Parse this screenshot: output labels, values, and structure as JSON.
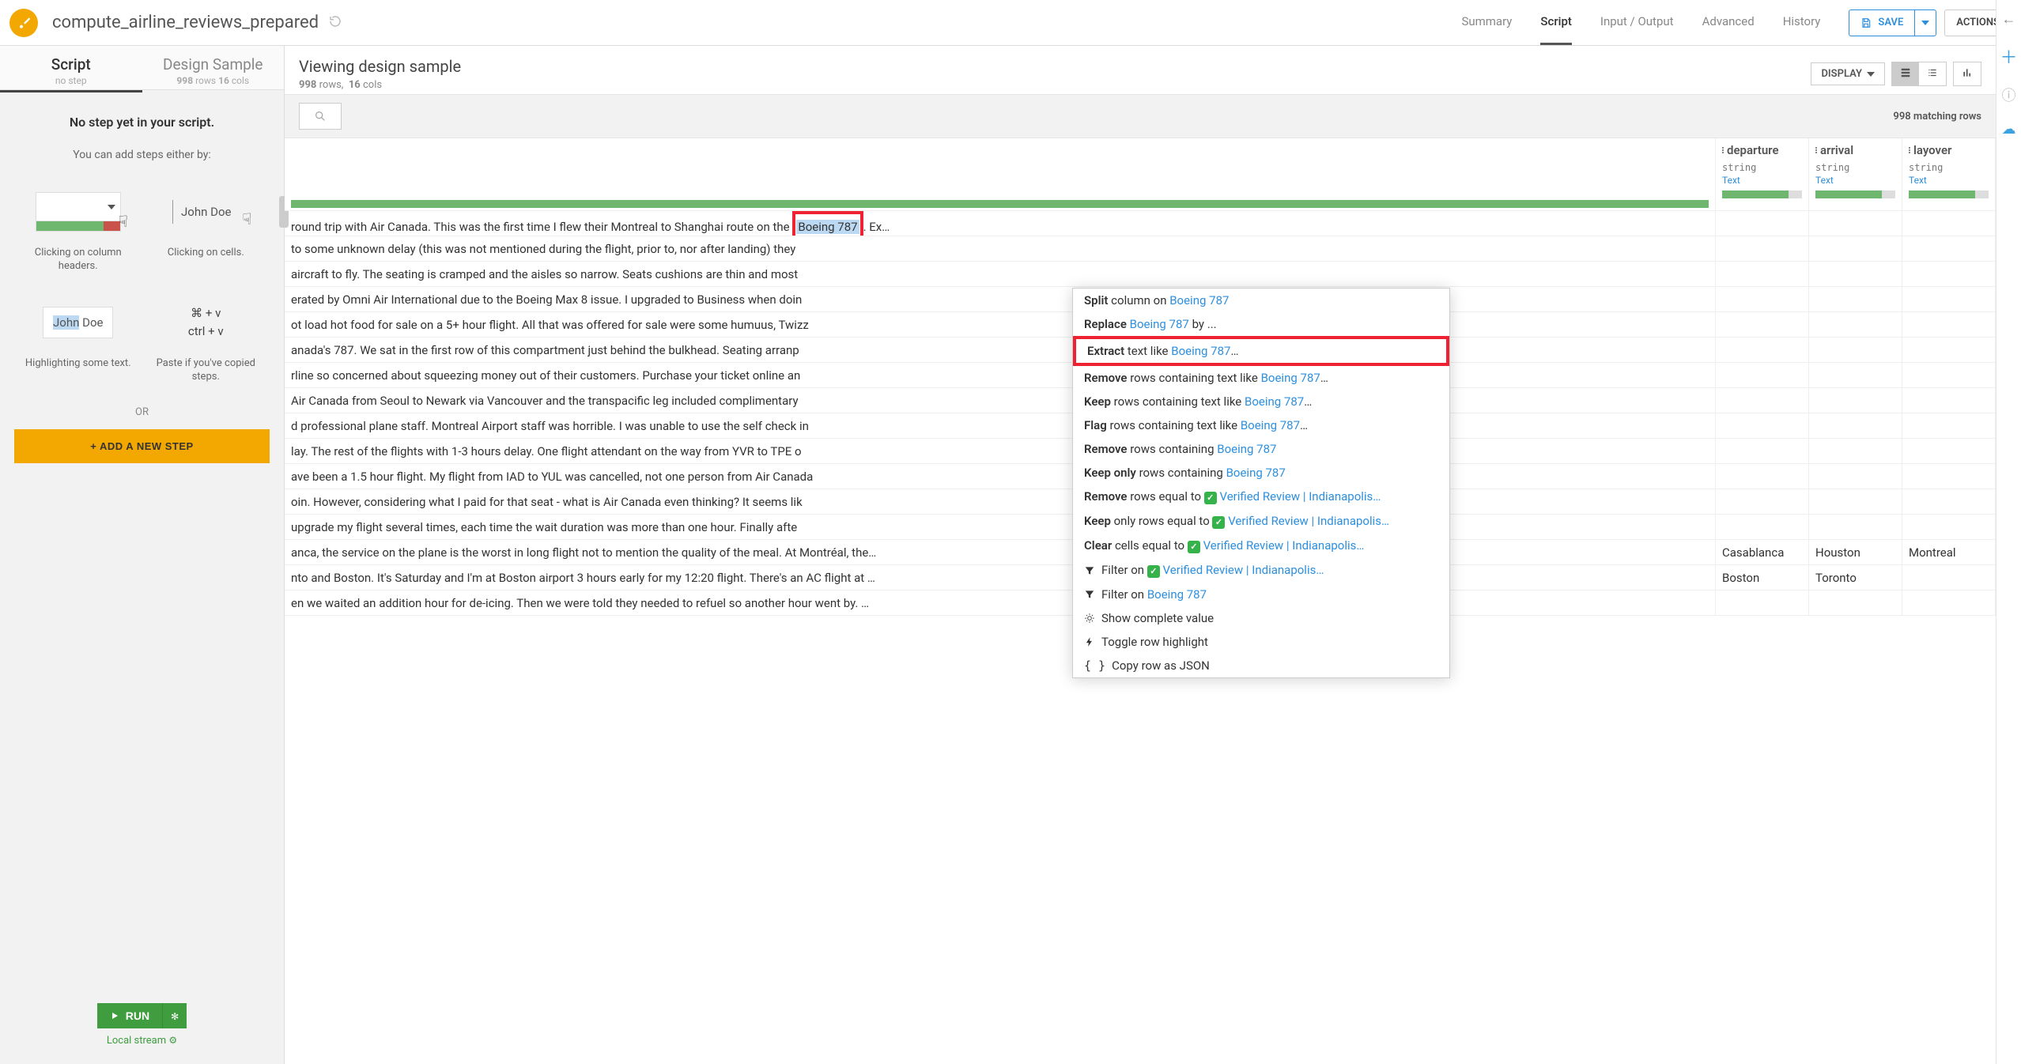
{
  "recipe_title": "compute_airline_reviews_prepared",
  "top_tabs": [
    "Summary",
    "Script",
    "Input / Output",
    "Advanced",
    "History"
  ],
  "top_tab_active": "Script",
  "save_label": "SAVE",
  "actions_label": "ACTIONS",
  "left": {
    "tab1": {
      "title": "Script",
      "sub": "no step"
    },
    "tab2": {
      "title": "Design Sample",
      "sub_rows": "998",
      "sub_rows_lbl": "rows",
      "sub_cols": "16",
      "sub_cols_lbl": "cols"
    },
    "no_step_msg": "No step yet in your script.",
    "add_intro": "You can add steps either by:",
    "hint_col": "Clicking on column headers.",
    "hint_cell_name": "John Doe",
    "hint_cell": "Clicking on cells.",
    "hint_hl_word": "John",
    "hint_hl_rest": " Doe",
    "hint_hl": "Highlighting some text.",
    "paste_line1": "⌘  +  v",
    "paste_line2": "ctrl  +  v",
    "hint_paste": "Paste if you've copied steps.",
    "or": "OR",
    "add_step_btn": "+ ADD A NEW STEP",
    "run_btn": "RUN",
    "local_stream": "Local stream"
  },
  "right": {
    "viewing": "Viewing design sample",
    "rows": "998",
    "rows_lbl": "rows,",
    "cols": "16",
    "cols_lbl": "cols",
    "display_label": "DISPLAY",
    "matching": "998 matching rows"
  },
  "columns": {
    "departure": {
      "label": "departure",
      "type": "string",
      "meaning": "Text"
    },
    "arrival": {
      "label": "arrival",
      "type": "string",
      "meaning": "Text"
    },
    "layover": {
      "label": "layover",
      "type": "string",
      "meaning": "Text"
    }
  },
  "selected_token": "Boeing 787",
  "rows": [
    {
      "review_pre": "round trip with Air Canada. This was the first time I flew their Montreal to Shanghai route on the ",
      "review_hit": "Boeing 787",
      "review_post": ". Ex…"
    },
    {
      "review": "to some unknown delay (this was not mentioned during the flight, prior to, nor after landing) they"
    },
    {
      "review": "aircraft to fly. The seating is cramped and the aisles so narrow. Seats cushions are thin and most"
    },
    {
      "review": "erated by Omni Air International due to the Boeing Max 8 issue. I upgraded to Business when doin"
    },
    {
      "review": "ot load hot food for sale on a 5+ hour flight. All that was offered for sale were some humuus, Twizz"
    },
    {
      "review": "anada's 787. We sat in the first row of this compartment just behind the bulkhead. Seating arranp"
    },
    {
      "review": "rline so concerned about squeezing money out of their customers. Purchase your ticket online an"
    },
    {
      "review": "Air Canada from Seoul to Newark via Vancouver and the transpacific leg included complimentary"
    },
    {
      "review": "d professional plane staff. Montreal Airport staff was horrible. I was unable to use the self check in"
    },
    {
      "review": "lay. The rest of the flights with 1-3 hours delay. One flight attendant on the way from YVR to TPE o"
    },
    {
      "review": "ave been a 1.5 hour flight. My flight from IAD to YUL was cancelled, not one person from Air Canada"
    },
    {
      "review": "oin. However, considering what I paid for that seat - what is Air Canada even thinking? It seems lik"
    },
    {
      "review": "upgrade my flight several times, each time the wait duration was more than one hour. Finally afte"
    },
    {
      "review": "anca, the service on the plane is the worst in long flight not to mention the quality of the meal. At Montréal, the…",
      "departure": "Casablanca",
      "arrival": "Houston",
      "layover": "Montreal"
    },
    {
      "review": "nto and Boston. It's Saturday and I'm at Boston airport 3 hours early for my 12:20 flight. There's an AC flight at …",
      "departure": "Boston",
      "arrival": "Toronto"
    },
    {
      "review": "en we waited an addition hour for de-icing. Then we were told they needed to refuel so another hour went by. …"
    }
  ],
  "menu": {
    "split": {
      "pre": "Split",
      "mid": " column on ",
      "link": "Boeing 787"
    },
    "replace": {
      "pre": "Replace ",
      "link": "Boeing 787",
      "post": " by ..."
    },
    "extract": {
      "pre": "Extract",
      "mid": " text like ",
      "link": "Boeing 787",
      "post": "…"
    },
    "remove_like": {
      "pre": "Remove",
      "mid": " rows containing text like ",
      "link": "Boeing 787",
      "post": "…"
    },
    "keep_like": {
      "pre": "Keep",
      "mid": " rows containing text like ",
      "link": "Boeing 787",
      "post": "…"
    },
    "flag_like": {
      "pre": "Flag",
      "mid": " rows containing text like ",
      "link": "Boeing 787",
      "post": "…"
    },
    "remove_containing": {
      "pre": "Remove",
      "mid": " rows containing ",
      "link": "Boeing 787"
    },
    "keep_containing": {
      "pre": "Keep only",
      "mid": " rows containing ",
      "link": "Boeing 787"
    },
    "remove_eq": {
      "pre": "Remove",
      "mid": " rows equal to ",
      "val": "Verified Review | Indianapolis…"
    },
    "keep_eq": {
      "pre": "Keep",
      "mid": " only rows equal to ",
      "val": "Verified Review | Indianapolis…"
    },
    "clear_eq": {
      "pre": "Clear",
      "mid": " cells equal to ",
      "val": "Verified Review | Indianapolis…"
    },
    "filter_val": {
      "pre": "Filter on ",
      "val": "Verified Review | Indianapolis…"
    },
    "filter_token": {
      "pre": "Filter on ",
      "link": "Boeing 787"
    },
    "show_complete": "Show complete value",
    "toggle_hl": "Toggle row highlight",
    "copy_json": "Copy row as JSON"
  }
}
